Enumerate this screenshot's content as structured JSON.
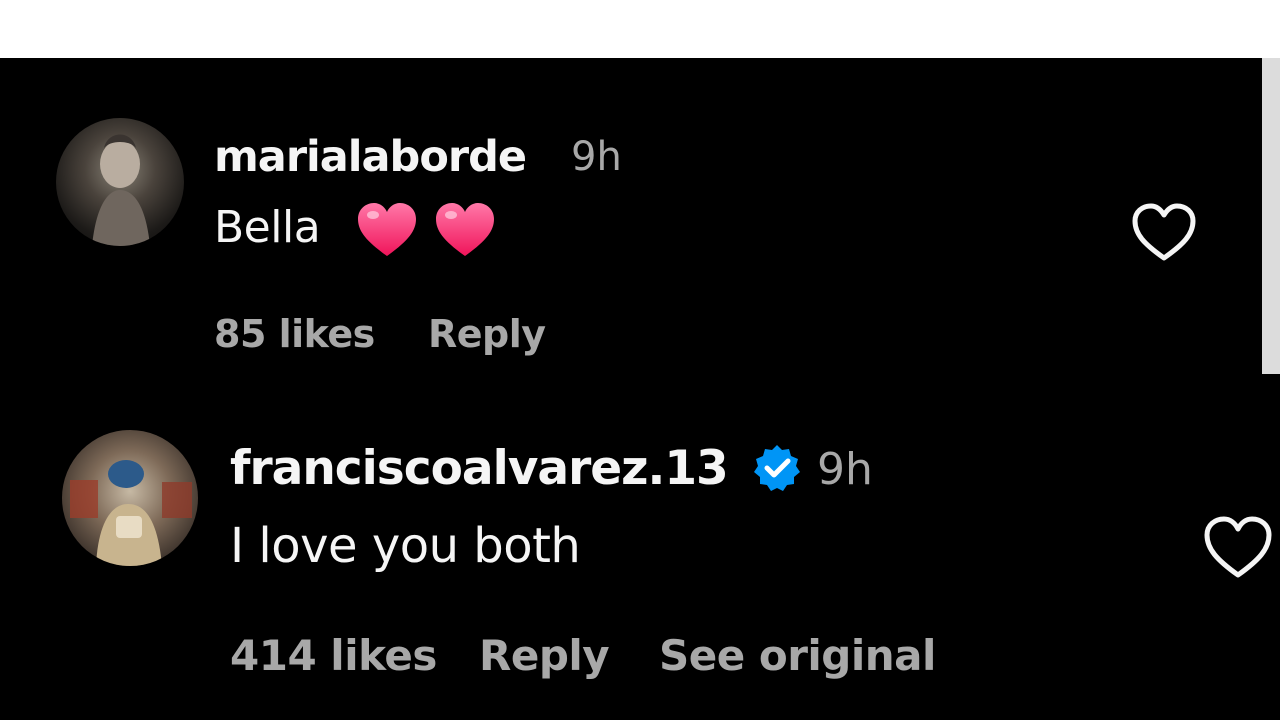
{
  "comments": [
    {
      "username": "marialaborde",
      "time": "9h",
      "text": "Bella",
      "emoji_count": 2,
      "likes": "85 likes",
      "reply": "Reply",
      "avatar_icon": "profile-photo"
    },
    {
      "username": "franciscoalvarez.13",
      "verified": true,
      "time": "9h",
      "text": "I love you both",
      "likes": "414 likes",
      "reply": "Reply",
      "see_original": "See original",
      "avatar_icon": "profile-photo"
    }
  ],
  "colors": {
    "background": "#000000",
    "text_primary": "#f5f5f5",
    "text_secondary": "#a8a8a8",
    "verified_blue": "#0095f6",
    "emoji_heart": "#ff3f7f"
  }
}
